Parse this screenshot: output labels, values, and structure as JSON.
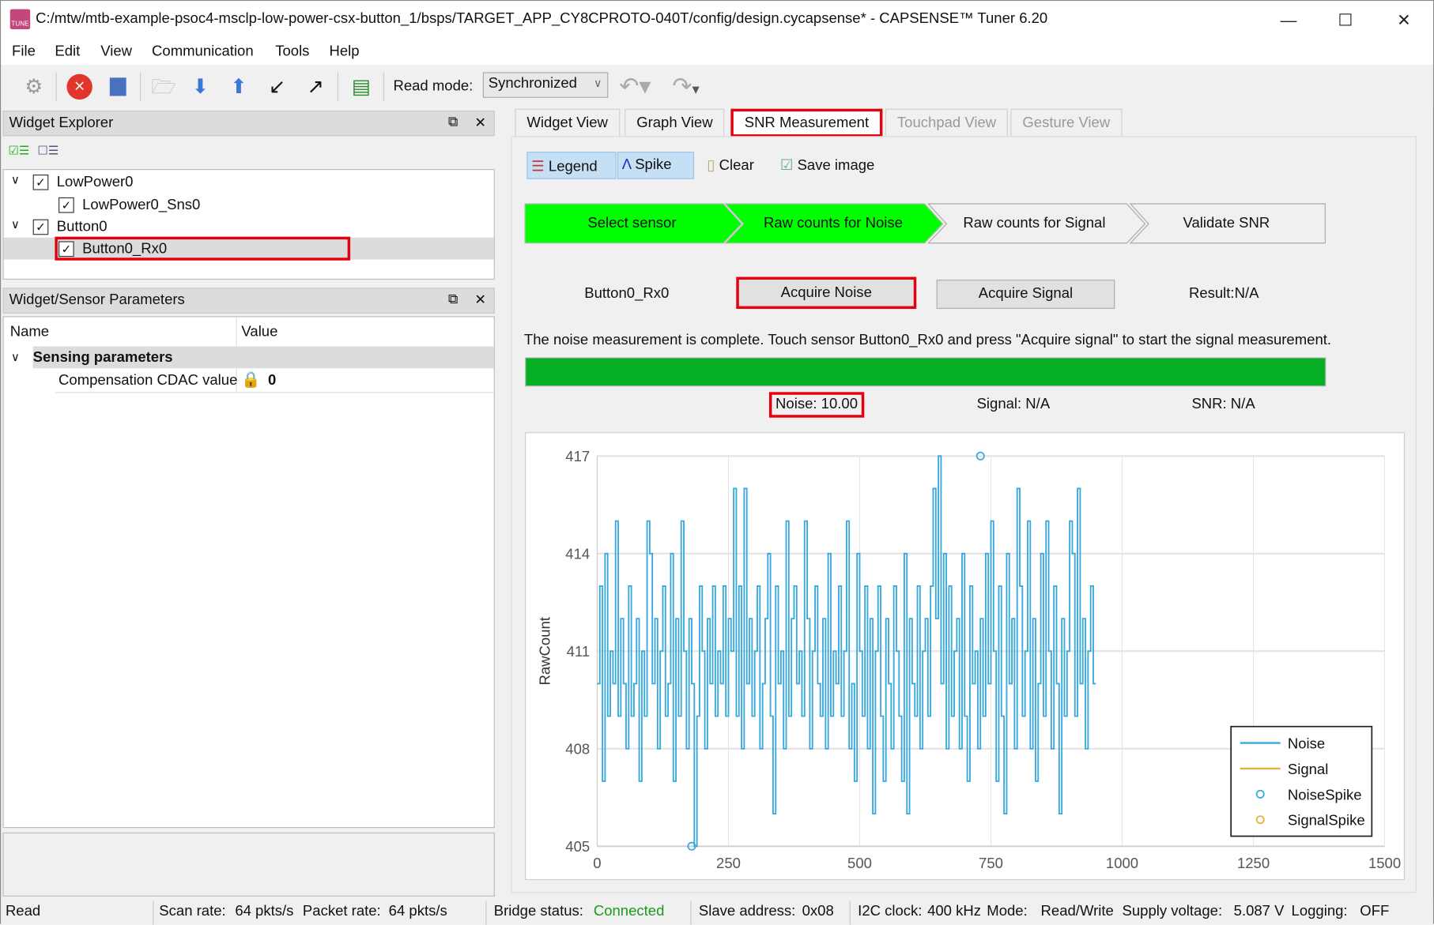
{
  "window": {
    "title": "C:/mtw/mtb-example-psoc4-msclp-low-power-csx-button_1/bsps/TARGET_APP_CY8CPROTO-040T/config/design.cycapsense* - CAPSENSE™ Tuner 6.20",
    "icon_text": "TUNE"
  },
  "menu": [
    "File",
    "Edit",
    "View",
    "Communication",
    "Tools",
    "Help"
  ],
  "toolbar": {
    "read_mode_label": "Read mode:",
    "read_mode_value": "Synchronized"
  },
  "widget_explorer": {
    "title": "Widget Explorer",
    "tree": [
      {
        "label": "LowPower0",
        "level": 0,
        "checked": true
      },
      {
        "label": "LowPower0_Sns0",
        "level": 1,
        "checked": true
      },
      {
        "label": "Button0",
        "level": 0,
        "checked": true
      },
      {
        "label": "Button0_Rx0",
        "level": 1,
        "checked": true,
        "selected": true
      }
    ]
  },
  "params": {
    "title": "Widget/Sensor Parameters",
    "col_name": "Name",
    "col_value": "Value",
    "group": "Sensing parameters",
    "rows": [
      {
        "name": "Compensation CDAC value",
        "value": "0"
      }
    ]
  },
  "tabs": [
    {
      "label": "Widget View"
    },
    {
      "label": "Graph View"
    },
    {
      "label": "SNR Measurement",
      "active": true
    },
    {
      "label": "Touchpad View",
      "disabled": true
    },
    {
      "label": "Gesture View",
      "disabled": true
    }
  ],
  "snr": {
    "tools": {
      "legend": "Legend",
      "spike": "Spike",
      "clear": "Clear",
      "save": "Save image"
    },
    "steps": [
      {
        "label": "Select sensor",
        "done": true
      },
      {
        "label": "Raw counts for Noise",
        "done": true
      },
      {
        "label": "Raw counts for Signal",
        "done": false
      },
      {
        "label": "Validate SNR",
        "done": false
      }
    ],
    "sensor": "Button0_Rx0",
    "acquire_noise": "Acquire Noise",
    "acquire_signal": "Acquire Signal",
    "result": "Result:N/A",
    "message": "The noise measurement is complete. Touch sensor Button0_Rx0 and press \"Acquire signal\" to start the signal measurement.",
    "progress_percent": 100,
    "noise": "Noise:  10.00",
    "signal": "Signal:  N/A",
    "snr": "SNR:  N/A",
    "colors": {
      "step_done": "#00ff00",
      "progress": "#06ae24",
      "noise_line": "#39a9dc",
      "signal_line": "#e3b13c",
      "highlight": "#e5000f"
    }
  },
  "chart_data": {
    "type": "line",
    "xlabel": "",
    "ylabel": "RawCount",
    "xlim": [
      0,
      1500
    ],
    "ylim": [
      405,
      417
    ],
    "xticks": [
      "0",
      "250",
      "500",
      "750",
      "1000",
      "1250",
      "1500"
    ],
    "yticks": [
      "405",
      "408",
      "411",
      "414",
      "417"
    ],
    "grid": true,
    "legend_position": "bottom-right",
    "legend": [
      "Noise",
      "Signal",
      "NoiseSpike",
      "SignalSpike"
    ],
    "series": [
      {
        "name": "Noise",
        "x_step": 5,
        "values": [
          410,
          413,
          407,
          414,
          409,
          411,
          410,
          415,
          409,
          412,
          410,
          408,
          413,
          409,
          410,
          412,
          407,
          411,
          409,
          415,
          414,
          410,
          412,
          408,
          411,
          413,
          409,
          410,
          414,
          407,
          412,
          409,
          415,
          411,
          408,
          412,
          410,
          405,
          409,
          413,
          411,
          408,
          412,
          410,
          413,
          409,
          411,
          410,
          413,
          409,
          412,
          411,
          416,
          409,
          413,
          408,
          416,
          410,
          412,
          409,
          411,
          413,
          408,
          410,
          412,
          414,
          409,
          406,
          413,
          410,
          411,
          408,
          415,
          409,
          412,
          413,
          410,
          411,
          409,
          415,
          412,
          408,
          411,
          413,
          410,
          409,
          412,
          408,
          414,
          409,
          411,
          410,
          413,
          409,
          411,
          415,
          408,
          410,
          407,
          414,
          411,
          409,
          413,
          408,
          412,
          406,
          411,
          413,
          409,
          407,
          412,
          410,
          408,
          413,
          411,
          409,
          407,
          414,
          406,
          412,
          410,
          409,
          413,
          408,
          411,
          412,
          409,
          413,
          416,
          412,
          417,
          410,
          414,
          408,
          413,
          409,
          411,
          412,
          408,
          414,
          409,
          407,
          413,
          410,
          411,
          408,
          412,
          409,
          414,
          410,
          415,
          411,
          407,
          413,
          409,
          406,
          414,
          410,
          412,
          408,
          416,
          413,
          409,
          411,
          415,
          408,
          412,
          407,
          410,
          414,
          409,
          415,
          411,
          408,
          413,
          410,
          406,
          412,
          409,
          411,
          415,
          414,
          409,
          416,
          410,
          412,
          408,
          411,
          413,
          410
        ]
      },
      {
        "name": "Signal",
        "values": []
      }
    ],
    "spikes": [
      {
        "name": "NoiseSpike",
        "x": 180,
        "y": 405
      },
      {
        "name": "NoiseSpike",
        "x": 730,
        "y": 417
      }
    ]
  },
  "statusbar": {
    "mode": "Read",
    "scan_rate_label": "Scan rate:",
    "scan_rate": "64 pkts/s",
    "packet_rate_label": "Packet rate:",
    "packet_rate": "64 pkts/s",
    "bridge_label": "Bridge status:",
    "bridge": "Connected",
    "slave_label": "Slave address:",
    "slave": "0x08",
    "i2c_label": "I2C clock:",
    "i2c": "400 kHz",
    "mode_label": "Mode:",
    "mode_value": "Read/Write",
    "supply_label": "Supply voltage:",
    "supply": "5.087 V",
    "logging_label": "Logging:",
    "logging": "OFF"
  }
}
